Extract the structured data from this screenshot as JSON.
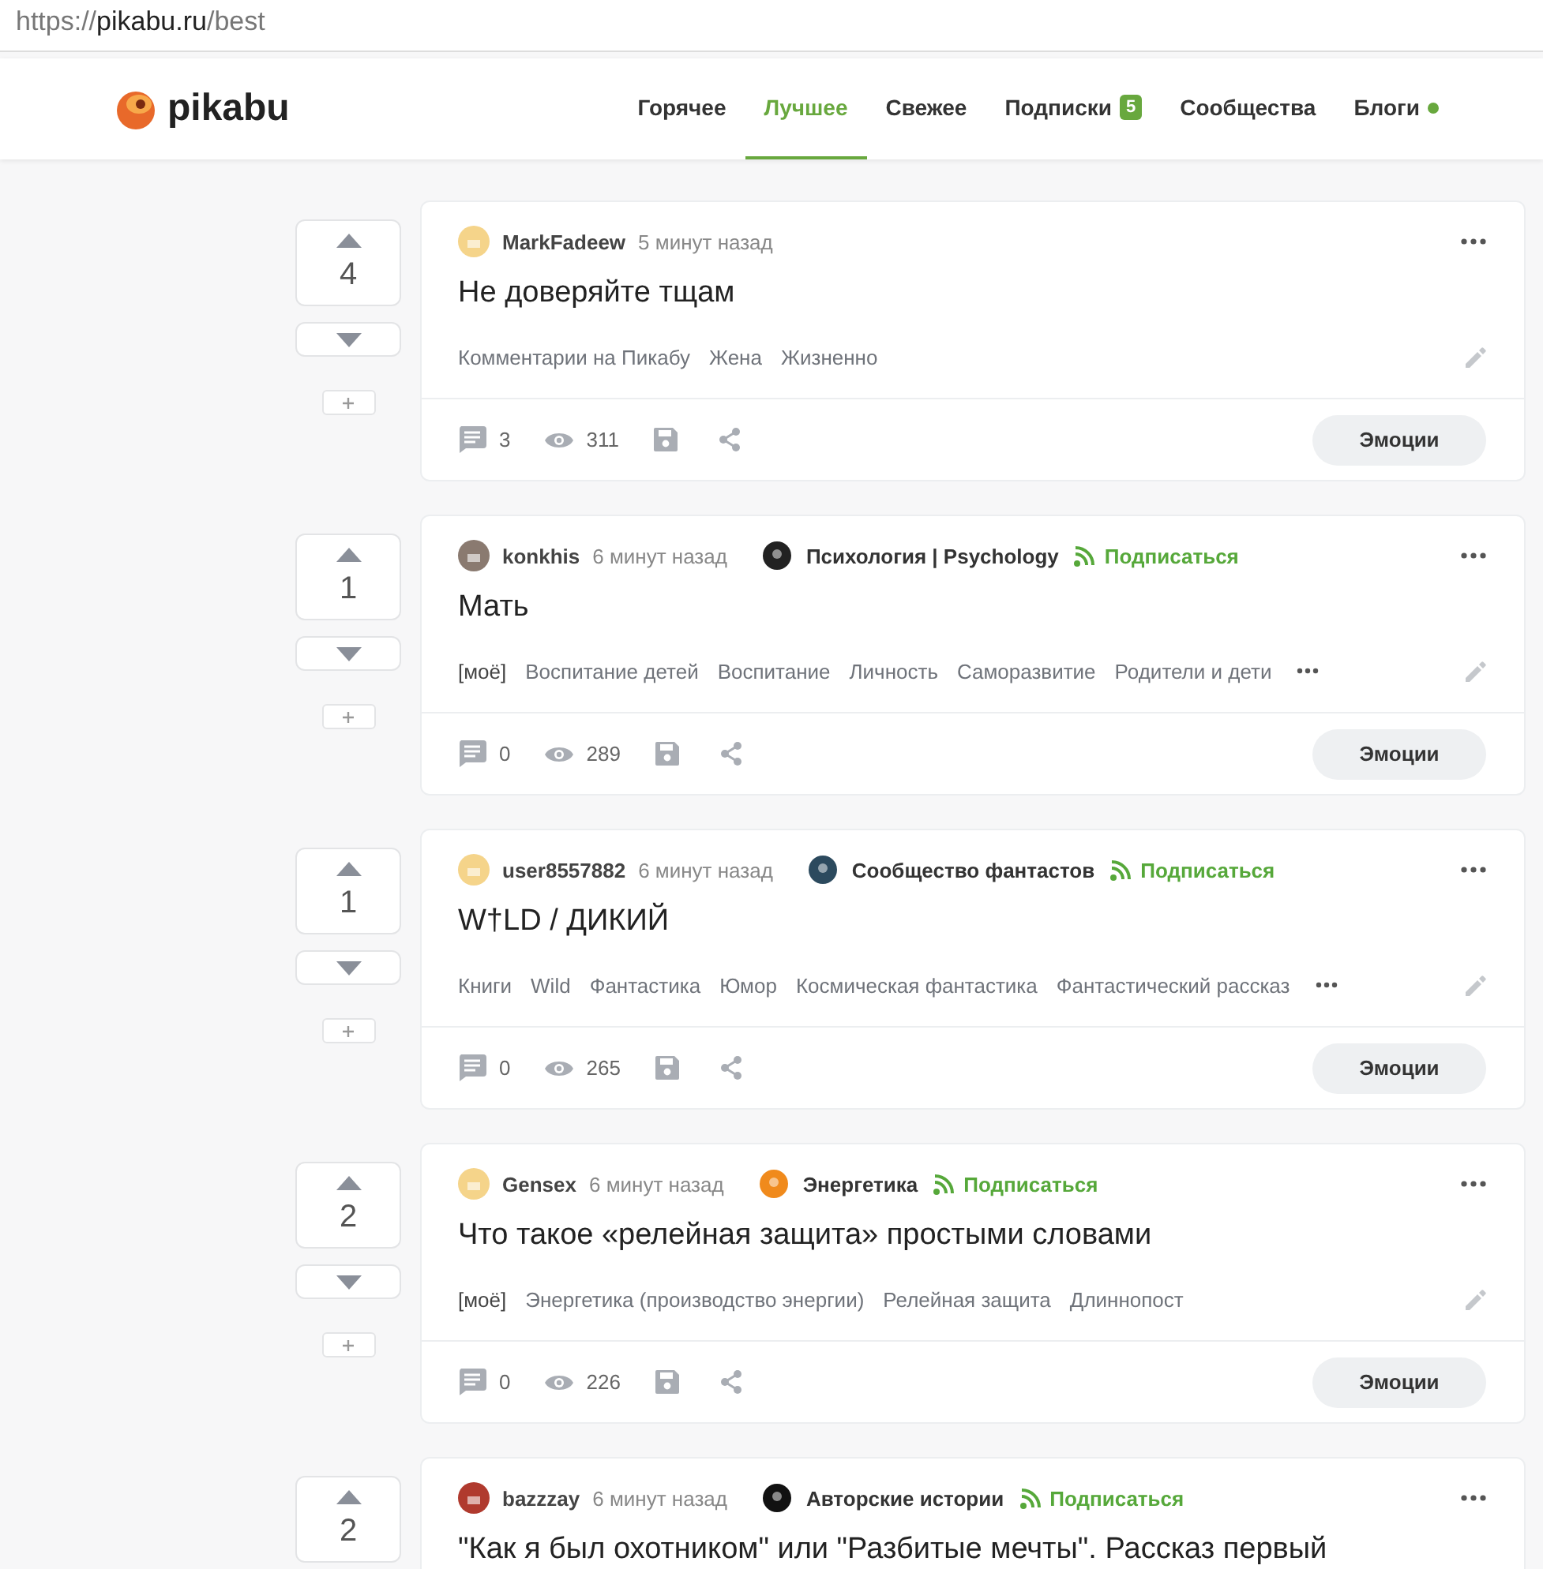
{
  "address_bar": {
    "url_prefix": "https://",
    "url_host": "pikabu.ru",
    "url_path": "/best"
  },
  "header": {
    "logo": "pikabu",
    "nav": [
      {
        "label": "Горячее",
        "selected": false
      },
      {
        "label": "Лучшее",
        "selected": true
      },
      {
        "label": "Свежее",
        "selected": false
      },
      {
        "label": "Подписки",
        "selected": false,
        "badge": "5"
      },
      {
        "label": "Сообщества",
        "selected": false
      },
      {
        "label": "Блоги",
        "selected": false,
        "dot": true
      }
    ]
  },
  "posts": [
    {
      "rating": "4",
      "author": "MarkFadeew",
      "time": "5 минут назад",
      "title": "Не доверяйте тщам",
      "tags": [
        {
          "text": "Комментарии на Пикабу",
          "kind": "tag"
        },
        {
          "text": "Жена",
          "kind": "tag"
        },
        {
          "text": "Жизненно",
          "kind": "tag"
        }
      ],
      "more_tags": false,
      "comments": "3",
      "views": "311",
      "emotions": "Эмоции"
    },
    {
      "rating": "1",
      "author": "konkhis",
      "time": "6 минут назад",
      "community": "Психология | Psychology",
      "subscribe": "Подписаться",
      "title": "Мать",
      "tags": [
        {
          "text": "[моё]",
          "kind": "mine"
        },
        {
          "text": "Воспитание детей",
          "kind": "tag"
        },
        {
          "text": "Воспитание",
          "kind": "tag"
        },
        {
          "text": "Личность",
          "kind": "tag"
        },
        {
          "text": "Саморазвитие",
          "kind": "tag"
        },
        {
          "text": "Родители и дети",
          "kind": "tag"
        }
      ],
      "more_tags": true,
      "comments": "0",
      "views": "289",
      "emotions": "Эмоции"
    },
    {
      "rating": "1",
      "author": "user8557882",
      "time": "6 минут назад",
      "community": "Сообщество фантастов",
      "subscribe": "Подписаться",
      "title": "W†LD / ДИКИЙ",
      "tags": [
        {
          "text": "Книги",
          "kind": "tag"
        },
        {
          "text": "Wild",
          "kind": "tag"
        },
        {
          "text": "Фантастика",
          "kind": "tag"
        },
        {
          "text": "Юмор",
          "kind": "tag"
        },
        {
          "text": "Космическая фантастика",
          "kind": "tag"
        },
        {
          "text": "Фантастический рассказ",
          "kind": "tag"
        }
      ],
      "more_tags": true,
      "comments": "0",
      "views": "265",
      "emotions": "Эмоции"
    },
    {
      "rating": "2",
      "author": "Gensex",
      "time": "6 минут назад",
      "community": "Энергетика",
      "subscribe": "Подписаться",
      "title": "Что такое «релейная защита» простыми словами",
      "tags": [
        {
          "text": "[моё]",
          "kind": "mine"
        },
        {
          "text": "Энергетика (производство энергии)",
          "kind": "tag"
        },
        {
          "text": "Релейная защита",
          "kind": "tag"
        },
        {
          "text": "Длиннопост",
          "kind": "tag"
        }
      ],
      "more_tags": false,
      "comments": "0",
      "views": "226",
      "emotions": "Эмоции"
    },
    {
      "rating": "2",
      "author": "bazzzay",
      "time": "6 минут назад",
      "community": "Авторские истории",
      "subscribe": "Подписаться",
      "title": "\"Как я был охотником\" или \"Разбитые мечты\". Рассказ первый"
    }
  ]
}
